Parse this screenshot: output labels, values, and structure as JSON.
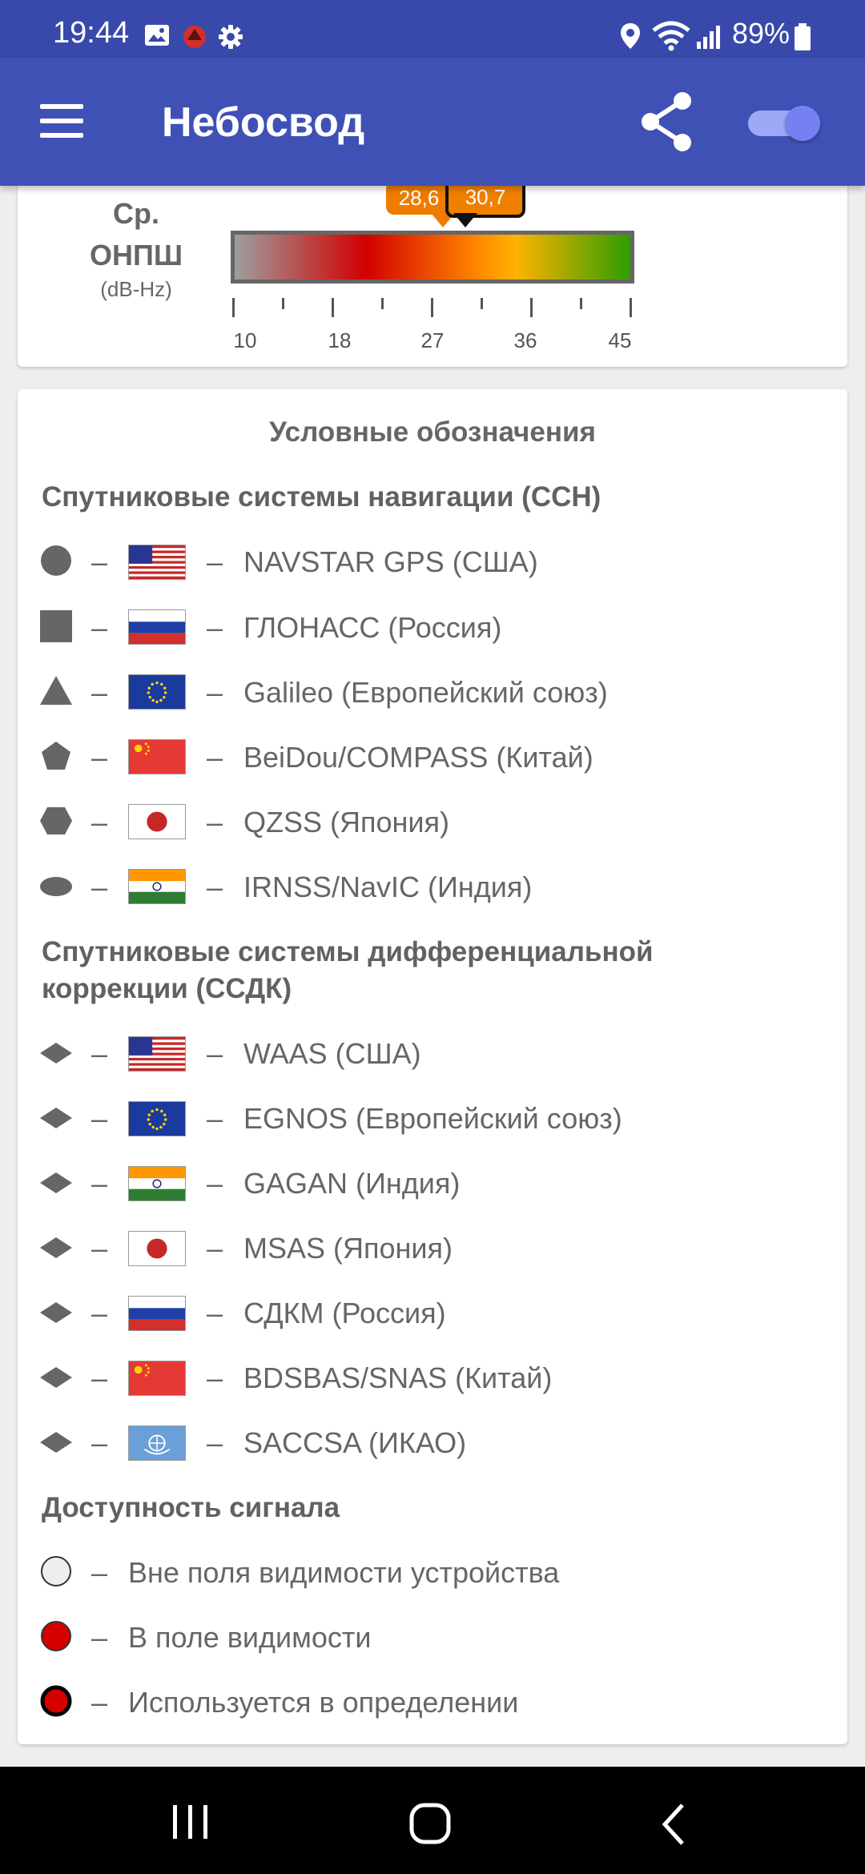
{
  "status_bar": {
    "time": "19:44",
    "battery": "89%",
    "icons": [
      "image-icon",
      "app-notification-icon",
      "gear-icon",
      "location-icon",
      "wifi-icon",
      "signal-icon",
      "battery-icon"
    ]
  },
  "app_bar": {
    "title": "Небосвод",
    "menu_icon": "menu-icon",
    "share_icon": "share-icon",
    "toggle_on": true
  },
  "snr": {
    "label_line1": "Ср.",
    "label_line2": "ОНПШ",
    "unit": "(dB-Hz)",
    "avg_value": "28,6",
    "current_value": "30,7",
    "scale_labels": [
      "10",
      "18",
      "27",
      "36",
      "45"
    ],
    "scale_min": 10,
    "scale_max": 45
  },
  "legend": {
    "title": "Условные обозначения",
    "gnss_heading": "Спутниковые системы навигации (ССН)",
    "gnss": [
      {
        "shape": "circle",
        "flag": "usa",
        "name": "NAVSTAR GPS (США)"
      },
      {
        "shape": "square",
        "flag": "russia",
        "name": "ГЛОНАСС (Россия)"
      },
      {
        "shape": "triangle",
        "flag": "eu",
        "name": "Galileo (Европейский союз)"
      },
      {
        "shape": "pentagon",
        "flag": "china",
        "name": "BeiDou/COMPASS (Китай)"
      },
      {
        "shape": "hexagon",
        "flag": "japan",
        "name": "QZSS (Япония)"
      },
      {
        "shape": "ellipse",
        "flag": "india",
        "name": "IRNSS/NavIC (Индия)"
      }
    ],
    "sbas_heading_line1": "Спутниковые системы дифференциальной",
    "sbas_heading_line2": "коррекции (ССДК)",
    "sbas": [
      {
        "shape": "diamond",
        "flag": "usa",
        "name": "WAAS (США)"
      },
      {
        "shape": "diamond",
        "flag": "eu",
        "name": "EGNOS (Европейский союз)"
      },
      {
        "shape": "diamond",
        "flag": "india",
        "name": "GAGAN (Индия)"
      },
      {
        "shape": "diamond",
        "flag": "japan",
        "name": "MSAS (Япония)"
      },
      {
        "shape": "diamond",
        "flag": "russia",
        "name": "СДКМ (Россия)"
      },
      {
        "shape": "diamond",
        "flag": "china",
        "name": "BDSBAS/SNAS (Китай)"
      },
      {
        "shape": "diamond",
        "flag": "icao",
        "name": "SACCSA (ИКАО)"
      }
    ],
    "signal_heading": "Доступность сигнала",
    "signal": [
      {
        "style": "not-visible",
        "name": "Вне поля видимости устройства"
      },
      {
        "style": "visible",
        "name": "В поле видимости"
      },
      {
        "style": "used",
        "name": "Используется в определении"
      }
    ],
    "dash": "–"
  },
  "nav_bar": {
    "icons": [
      "recent-apps-icon",
      "home-icon",
      "back-icon"
    ]
  },
  "colors": {
    "primary": "#3f51b5",
    "status_bar": "#3949ab",
    "signal_red": "#d50000",
    "bubble_orange": "#ef7c00"
  }
}
